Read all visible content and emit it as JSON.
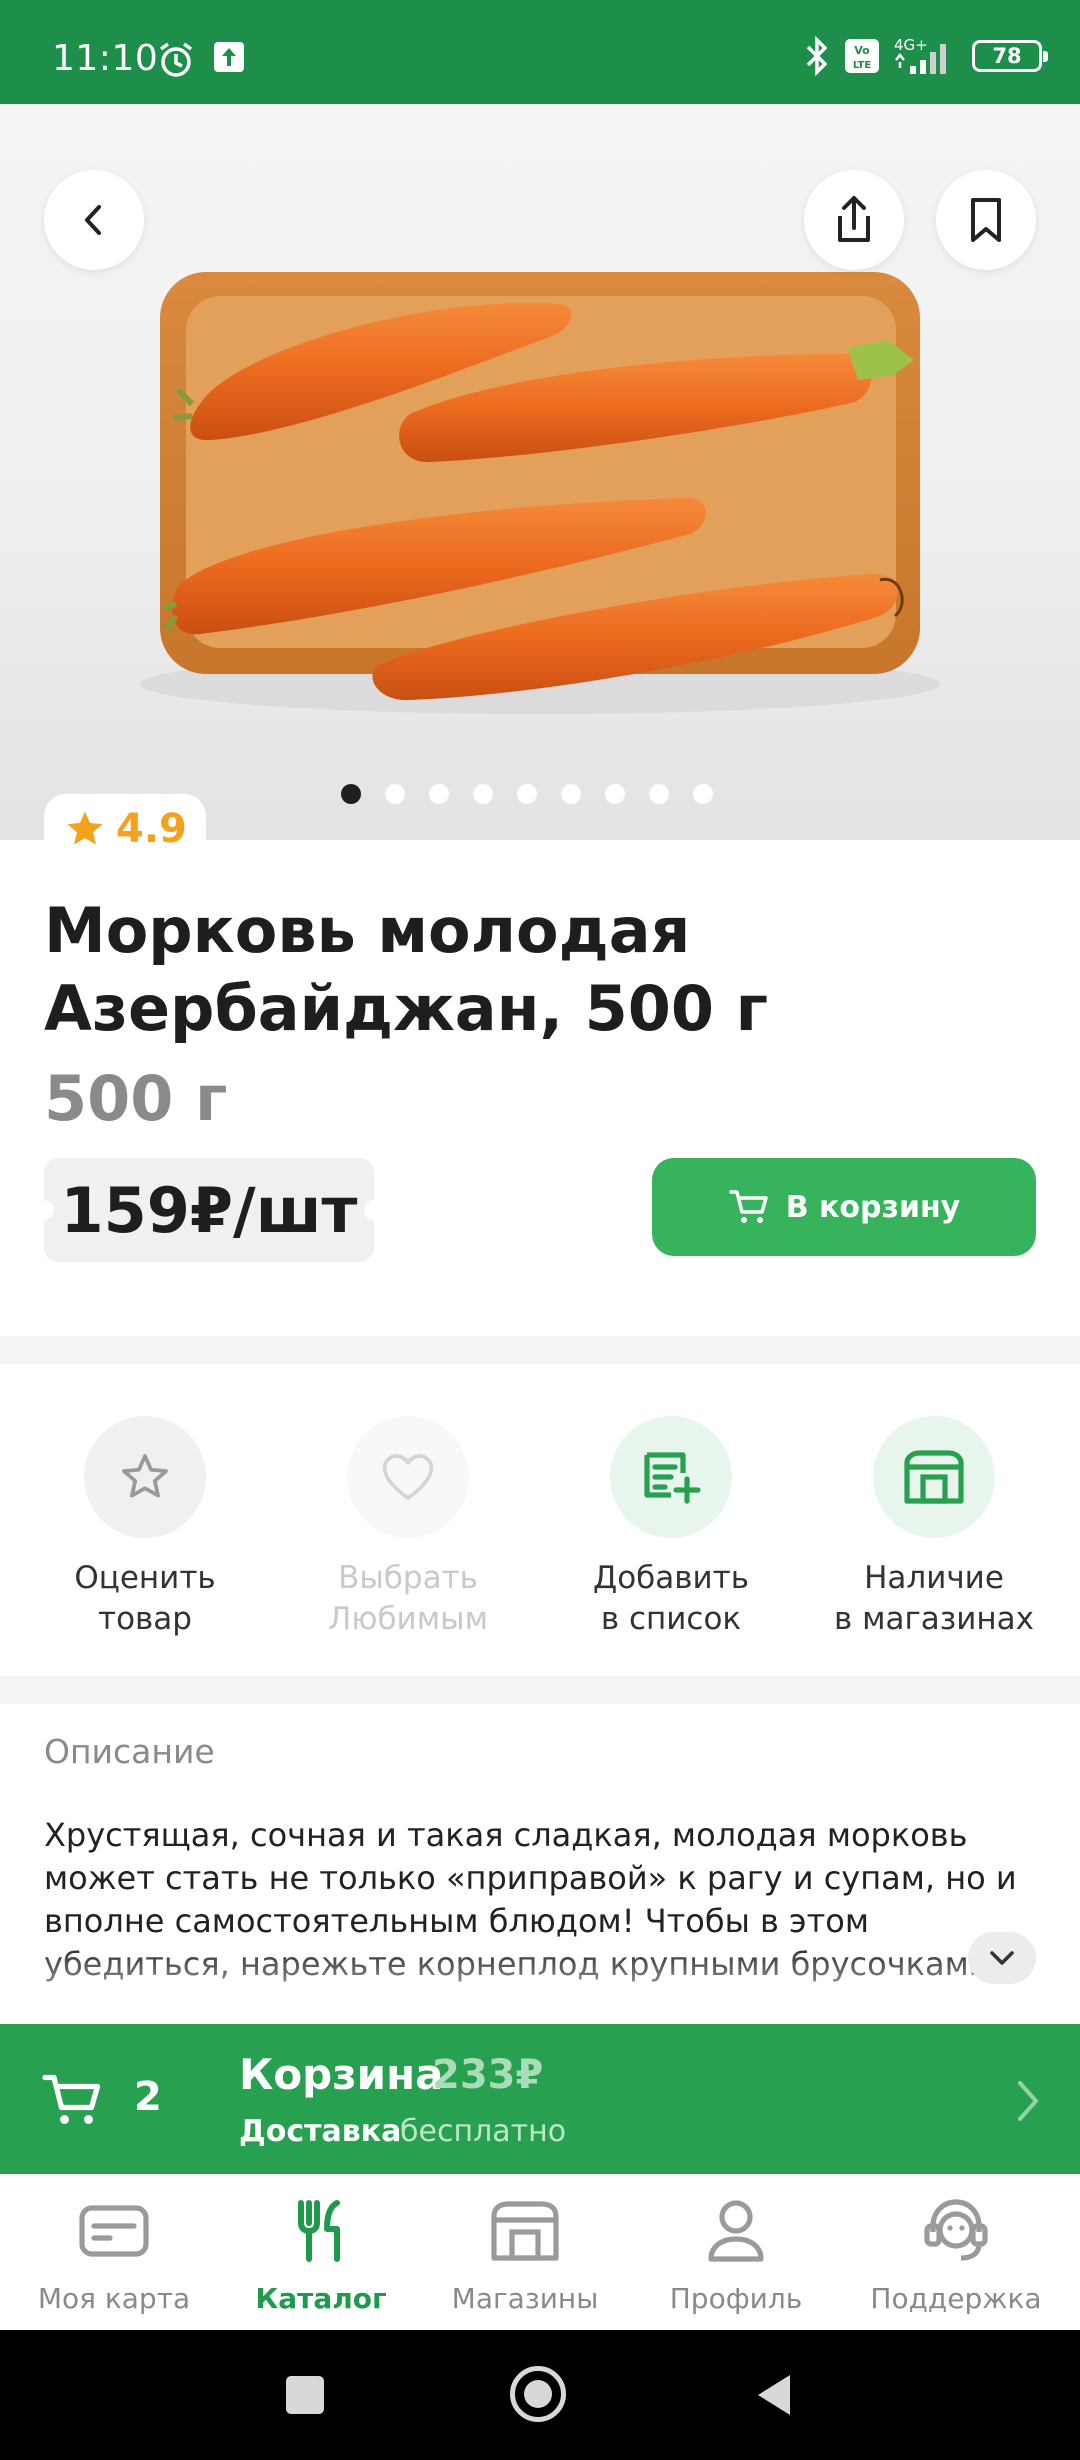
{
  "status_bar": {
    "time": "11:10",
    "battery": "78",
    "network": "4G+"
  },
  "hero": {
    "image_description": "carrots-in-tray",
    "slide_count": 9,
    "active_slide": 1
  },
  "product": {
    "rating": "4.9",
    "title": "Морковь молодая Азербайджан, 500 г",
    "weight": "500 г",
    "price": "159₽/шт",
    "add_to_cart_label": "В корзину"
  },
  "actions": [
    {
      "label_line1": "Оценить",
      "label_line2": "товар",
      "icon": "star-icon",
      "enabled": true
    },
    {
      "label_line1": "Выбрать",
      "label_line2": "Любимым",
      "icon": "heart-icon",
      "enabled": false
    },
    {
      "label_line1": "Добавить",
      "label_line2": "в список",
      "icon": "add-to-list-icon",
      "enabled": true
    },
    {
      "label_line1": "Наличие",
      "label_line2": "в магазинах",
      "icon": "store-icon",
      "enabled": true
    }
  ],
  "description": {
    "title": "Описание",
    "text": "Хрустящая, сочная и такая сладкая, молодая морковь может стать не только «приправой» к рагу и супам, но и вполне самостоятельным блюдом! Чтобы в этом убедиться, нарежьте корнеплод крупными брусочками"
  },
  "cart_bar": {
    "count": "2",
    "title": "Корзина",
    "total": "233₽",
    "delivery_label": "Доставка",
    "delivery_value": "бесплатно"
  },
  "bottom_nav": [
    {
      "label": "Моя карта",
      "icon": "card-icon",
      "active": false
    },
    {
      "label": "Каталог",
      "icon": "catalog-icon",
      "active": true
    },
    {
      "label": "Магазины",
      "icon": "store-icon",
      "active": false
    },
    {
      "label": "Профиль",
      "icon": "profile-icon",
      "active": false
    },
    {
      "label": "Поддержка",
      "icon": "support-icon",
      "active": false
    }
  ],
  "colors": {
    "brand_green": "#1e8f4a",
    "button_green": "#36b35c",
    "cart_bar_green": "#27a04f",
    "rating_orange": "#f4a21c"
  }
}
